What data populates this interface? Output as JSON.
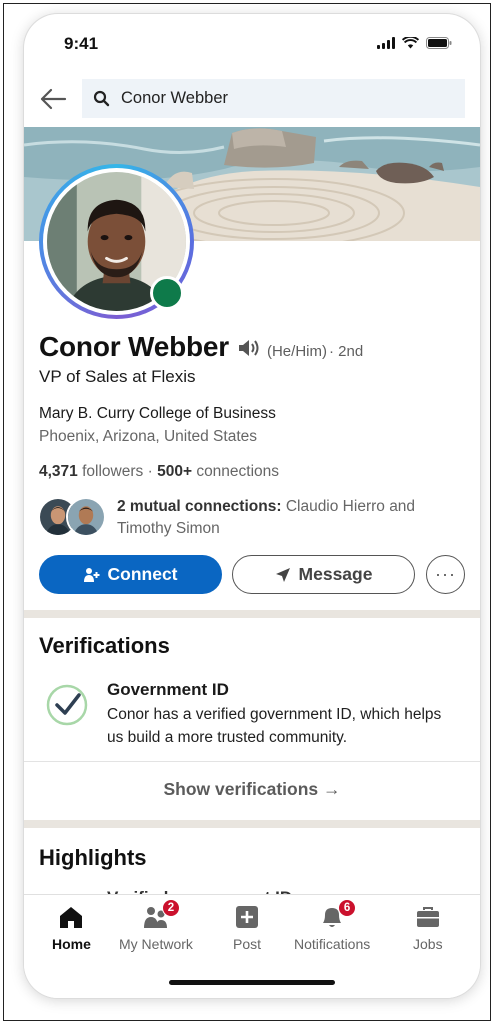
{
  "status_bar": {
    "time": "9:41"
  },
  "search": {
    "query": "Conor Webber"
  },
  "profile": {
    "name": "Conor Webber",
    "pronouns": "(He/Him)",
    "degree": "· 2nd",
    "headline": "VP of Sales at Flexis",
    "school": "Mary B. Curry College of Business",
    "location": "Phoenix, Arizona, United States",
    "followers_count": "4,371",
    "followers_label": "followers",
    "separator": "·",
    "connections_count": "500+",
    "connections_label": "connections",
    "mutual_bold": "2 mutual connections:",
    "mutual_names": "Claudio Hierro and Timothy Simon",
    "online_color": "#0e7a4a"
  },
  "actions": {
    "connect_label": "Connect",
    "message_label": "Message",
    "more_label": "···",
    "primary_color": "#0a66c2"
  },
  "verifications": {
    "title": "Verifications",
    "item_title": "Government ID",
    "item_desc": "Conor has a verified government ID, which helps us build a more trusted community.",
    "show_label": "Show verifications →"
  },
  "highlights": {
    "title": "Highlights",
    "peek_text": "Verified government ID"
  },
  "bottom_nav": {
    "items": [
      {
        "label": "Home",
        "icon": "home-icon",
        "active": true
      },
      {
        "label": "My Network",
        "icon": "network-icon",
        "badge": "2"
      },
      {
        "label": "Post",
        "icon": "post-icon"
      },
      {
        "label": "Notifications",
        "icon": "bell-icon",
        "badge": "6"
      },
      {
        "label": "Jobs",
        "icon": "briefcase-icon"
      }
    ],
    "badge_color": "#cb112d"
  }
}
